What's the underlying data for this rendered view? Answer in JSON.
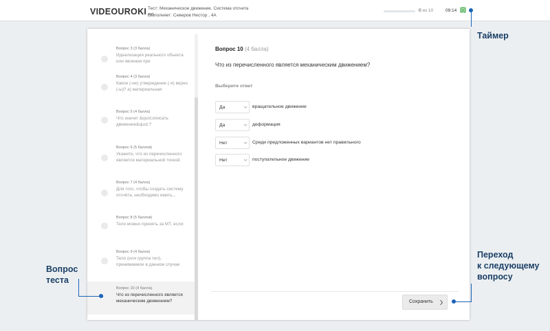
{
  "header": {
    "logo_main": "VIDEOUROKI",
    "logo_suffix": ".net",
    "test_title": "Тест: Механическое движение. Система отсчета",
    "performer": "Выполняет: Северов Нестор , 4А",
    "progress_done": "0",
    "progress_of": "из 10",
    "progress_fraction": 0.0,
    "timer": "09:14",
    "timer_icon": "alarm-clock-icon"
  },
  "sidebar": {
    "items": [
      {
        "meta": "Вопрос 3 (3 балла)",
        "text": "Идеализация реального объекта или явления при"
      },
      {
        "meta": "Вопрос 4 (3 балла)",
        "text": "Какое (-ие) утверждение (-я) верно (-ы)? а) материальная"
      },
      {
        "meta": "Вопрос 5 (4 балла)",
        "text": "Что значит &quot;описать движение&quot;?"
      },
      {
        "meta": "Вопрос 6 (5 баллов)",
        "text": "Укажите, что из перечисленного является материальной точкой."
      },
      {
        "meta": "Вопрос 7 (4 балла)",
        "text": "Для того, чтобы создать систему отсчёта, необходимо иметь..."
      },
      {
        "meta": "Вопрос 8 (5 баллов)",
        "text": "Тело можно принять за МТ, если:"
      },
      {
        "meta": "Вопрос 9 (4 балла)",
        "text": "Тело (или группа тел), принимаемое в данном случае"
      },
      {
        "meta": "Вопрос 10 (4 балла)",
        "text": "Что из перечисленного является механическим движением?"
      }
    ]
  },
  "question": {
    "title": "Вопрос 10",
    "points": "(4 балла)",
    "text": "Что из перечисленного является механическим движением?",
    "choose_label": "Выберите ответ",
    "answers": [
      {
        "value": "Да",
        "label": "вращательное движение"
      },
      {
        "value": "Да",
        "label": "деформация"
      },
      {
        "value": "Нет",
        "label": "Среди предложенных вариантов нет правильного"
      },
      {
        "value": "Нет",
        "label": "поступательное движение"
      }
    ],
    "save_label": "Сохранить"
  },
  "annotations": {
    "timer": "Таймер",
    "question_line1": "Вопрос",
    "question_line2": "теста",
    "next_line1": "Переход",
    "next_line2": "к следующему",
    "next_line3": "вопросу"
  },
  "colors": {
    "accent": "#1b63b8",
    "timer_icon": "#4caf50",
    "annotation_text": "#1a3f66"
  }
}
